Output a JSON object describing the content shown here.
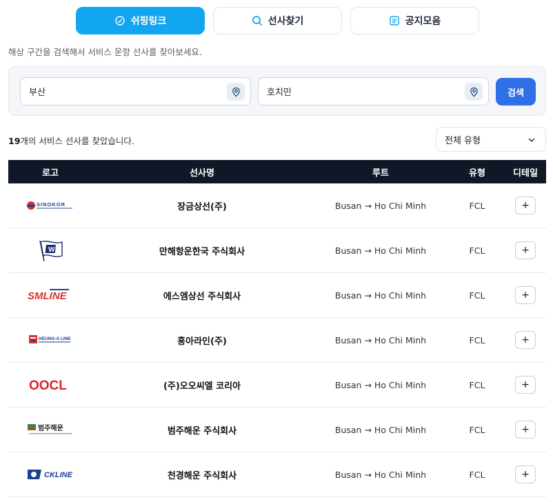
{
  "tabs": [
    {
      "label": "쉬핑링크",
      "icon": "compass-icon",
      "active": true
    },
    {
      "label": "선사찾기",
      "icon": "search-icon",
      "active": false
    },
    {
      "label": "공지모음",
      "icon": "notice-icon",
      "active": false
    }
  ],
  "description": "해상 구간을 검색해서 서비스 운항 선사를 찾아보세요.",
  "search": {
    "origin_value": "부산",
    "destination_value": "호치민",
    "button_label": "검색"
  },
  "result": {
    "count": "19",
    "count_suffix": "개의 서비스 선사를 찾았습니다."
  },
  "type_filter": {
    "selected": "전체 유형"
  },
  "table": {
    "headers": {
      "logo": "로고",
      "name": "선사명",
      "route": "루트",
      "type": "유형",
      "detail": "디테일"
    },
    "rows": [
      {
        "logo": "sinokor-logo",
        "logo_text": "SINOKOR",
        "name": "장금상선(주)",
        "route": "Busan → Ho Chi Minh",
        "type": "FCL",
        "detail": "+"
      },
      {
        "logo": "wanhai-logo",
        "logo_text": "W",
        "name": "만해항운한국 주식회사",
        "route": "Busan → Ho Chi Minh",
        "type": "FCL",
        "detail": "+"
      },
      {
        "logo": "smline-logo",
        "logo_text": "SMLINE",
        "name": "에스엠상선 주식회사",
        "route": "Busan → Ho Chi Minh",
        "type": "FCL",
        "detail": "+"
      },
      {
        "logo": "heungaline-logo",
        "logo_text": "HEUNG-A LINE",
        "name": "흥아라인(주)",
        "route": "Busan → Ho Chi Minh",
        "type": "FCL",
        "detail": "+"
      },
      {
        "logo": "oocl-logo",
        "logo_text": "OOCL",
        "name": "(주)오오씨엘 코리아",
        "route": "Busan → Ho Chi Minh",
        "type": "FCL",
        "detail": "+"
      },
      {
        "logo": "pancon-logo",
        "logo_text": "범주해운",
        "name": "범주해운 주식회사",
        "route": "Busan → Ho Chi Minh",
        "type": "FCL",
        "detail": "+"
      },
      {
        "logo": "ckline-logo",
        "logo_text": "CKLINE",
        "name": "천경해운 주식회사",
        "route": "Busan → Ho Chi Minh",
        "type": "FCL",
        "detail": "+"
      }
    ]
  },
  "colors": {
    "accent": "#13a6f0",
    "primary_button": "#2f6fe8",
    "table_header": "#101828"
  }
}
